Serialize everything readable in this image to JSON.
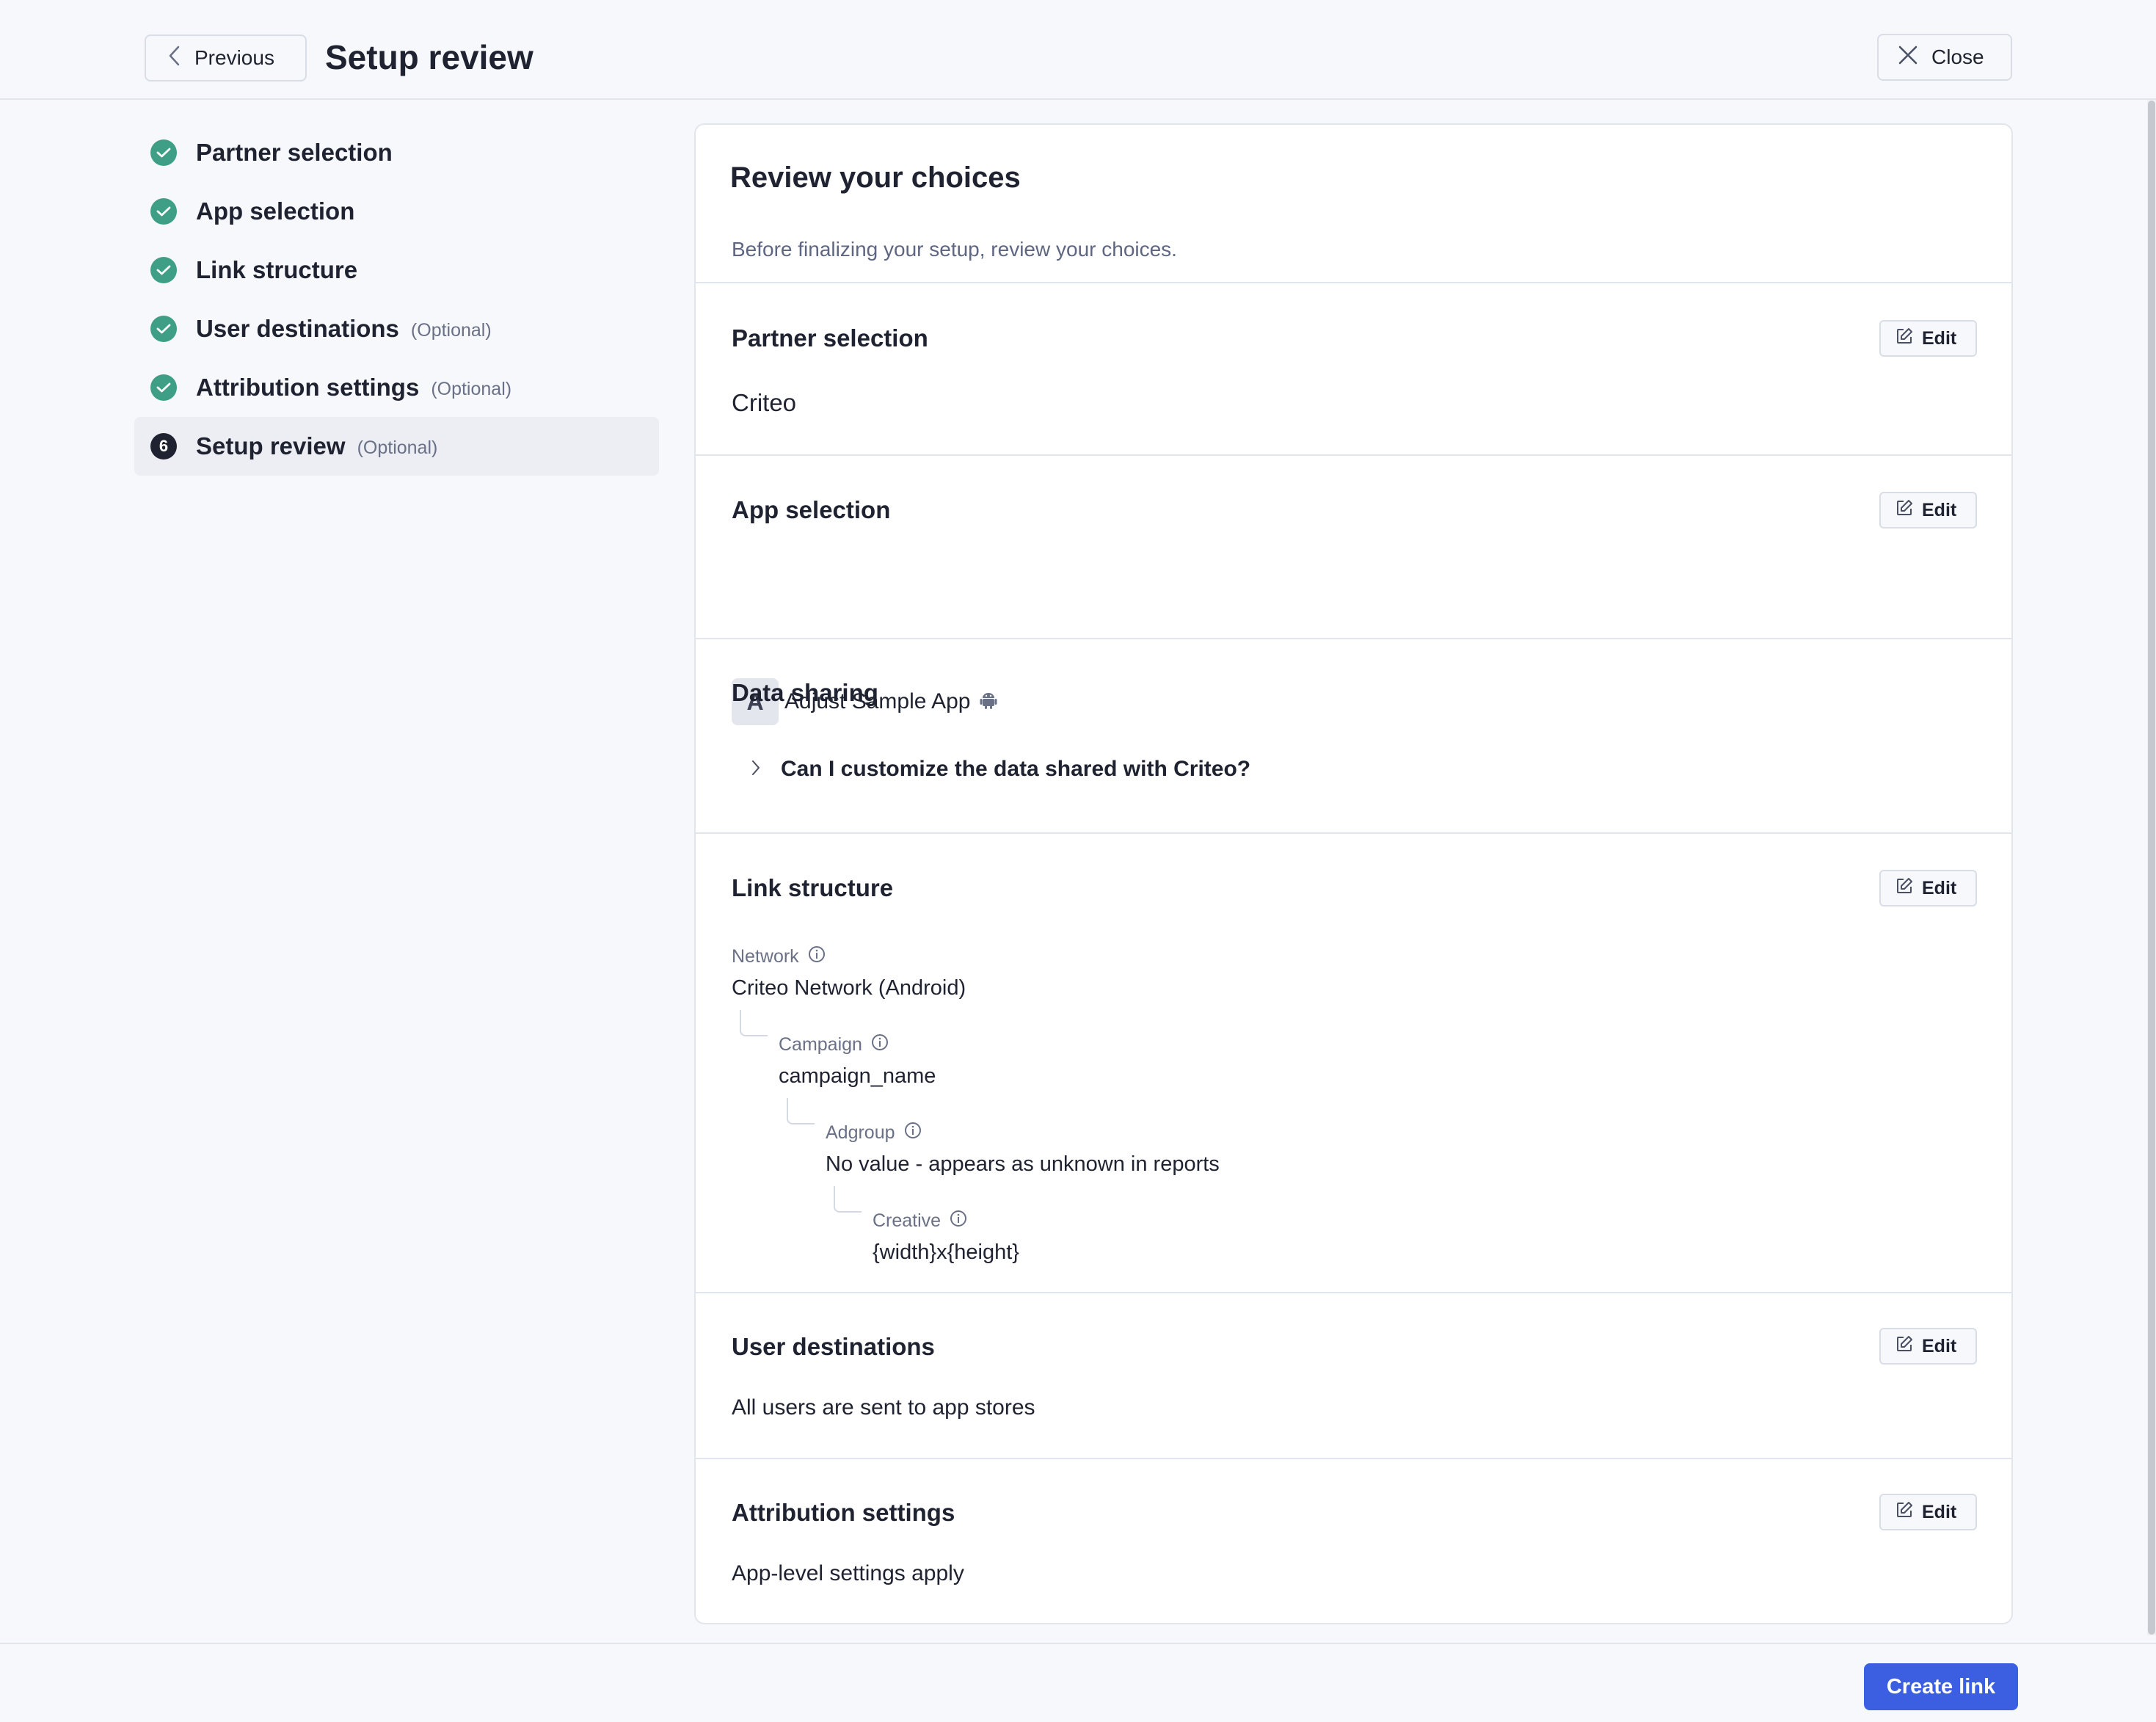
{
  "header": {
    "previous_label": "Previous",
    "title": "Setup review",
    "close_label": "Close"
  },
  "steps": [
    {
      "label": "Partner selection",
      "optional": "",
      "status": "done"
    },
    {
      "label": "App selection",
      "optional": "",
      "status": "done"
    },
    {
      "label": "Link structure",
      "optional": "",
      "status": "done"
    },
    {
      "label": "User destinations",
      "optional": "(Optional)",
      "status": "done"
    },
    {
      "label": "Attribution settings",
      "optional": "(Optional)",
      "status": "done"
    },
    {
      "label": "Setup review",
      "optional": "(Optional)",
      "status": "current",
      "number": "6"
    }
  ],
  "card": {
    "title": "Review your choices",
    "subtitle": "Before finalizing your setup, review your choices.",
    "edit_label": "Edit",
    "partner": {
      "title": "Partner selection",
      "value": "Criteo"
    },
    "app": {
      "title": "App selection",
      "avatar_letter": "A",
      "name": "Adjust Sample App",
      "platform_icon": "android-icon"
    },
    "data_sharing": {
      "title": "Data sharing",
      "question": "Can I customize the data shared with Criteo?"
    },
    "link_structure": {
      "title": "Link structure",
      "network_label": "Network",
      "network_value": "Criteo Network (Android)",
      "campaign_label": "Campaign",
      "campaign_value": "campaign_name",
      "adgroup_label": "Adgroup",
      "adgroup_value": "No value - appears as unknown in reports",
      "creative_label": "Creative",
      "creative_value": "{width}x{height}"
    },
    "user_destinations": {
      "title": "User destinations",
      "value": "All users are sent to app stores"
    },
    "attribution": {
      "title": "Attribution settings",
      "value": "App-level settings apply"
    }
  },
  "footer": {
    "create_label": "Create link"
  },
  "colors": {
    "accent": "#3b5fe0",
    "success": "#3e9f86",
    "background": "#f6f8fb"
  }
}
